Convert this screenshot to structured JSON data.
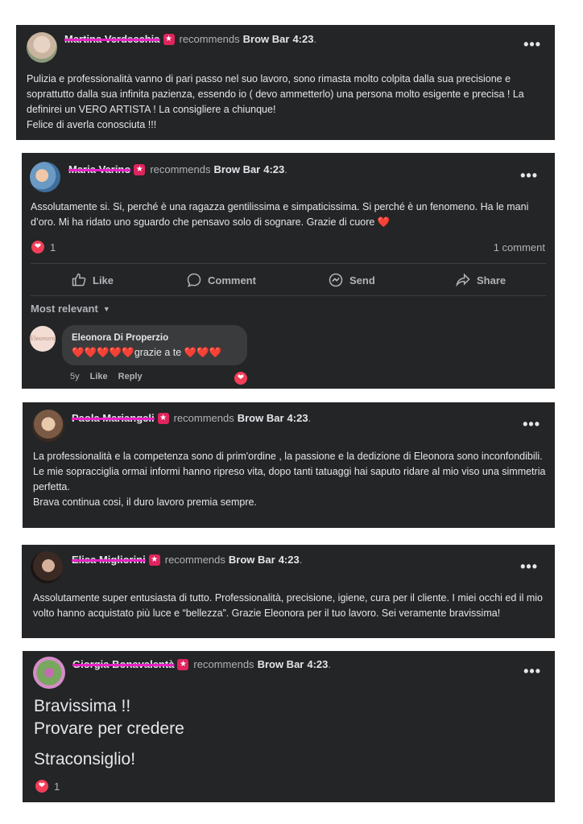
{
  "page_name": "Brow Bar",
  "recommends_text": "recommends",
  "posts": [
    {
      "author": "Martina Verdecchia",
      "time": "4:23",
      "text": "Pulizia e professionalità vanno di pari passo nel suo lavoro, sono rimasta molto colpita  dalla sua precisione e soprattutto dalla sua infinita pazienza, essendo io ( devo ammetterlo) una persona molto esigente e precisa ! La definirei un VERO ARTISTA ! La consigliere a chiunque!\nFelice di averla conosciuta !!!"
    },
    {
      "author": "Maria Varino",
      "time": "4:23",
      "text": "Assolutamente si. Si, perché è una ragazza gentilissima e simpaticissima. Si perché è un fenomeno. Ha le mani d’oro. Mi ha ridato uno sguardo che pensavo solo di sognare. Grazie di cuore ❤️",
      "reaction_count": "1",
      "comment_count": "1 comment",
      "actions": {
        "like": "Like",
        "comment": "Comment",
        "send": "Send",
        "share": "Share"
      },
      "sort_label": "Most relevant",
      "comment": {
        "author": "Eleonora Di Properzio",
        "text": "❤️❤️❤️❤️❤️grazie a te ❤️❤️❤️",
        "age": "5y",
        "like": "Like",
        "reply": "Reply"
      }
    },
    {
      "author": "Paola Mariangeli",
      "time": "4:23",
      "text": "La professionalità e la competenza sono di prim'ordine , la passione e la dedizione di Eleonora  sono inconfondibili.\nLe mie sopracciglia ormai informi hanno ripreso vita, dopo tanti tatuaggi hai saputo ridare al mio viso una simmetria perfetta.\nBrava continua cosi, il duro lavoro premia sempre."
    },
    {
      "author": "Elisa Migliorini",
      "time": "4:23",
      "text": "Assolutamente super entusiasta di tutto. Professionalità, precisione, igiene, cura per il cliente. I miei occhi ed il mio volto hanno acquistato più luce e “bellezza”. Grazie Eleonora per il tuo lavoro. Sei veramente bravissima!"
    },
    {
      "author": "Giorgia Bonavalentà",
      "time": "4:23",
      "line1": "Bravissima !!",
      "line2": "Provare per credere",
      "line3": "Straconsiglio!",
      "reaction_count": "1"
    }
  ]
}
